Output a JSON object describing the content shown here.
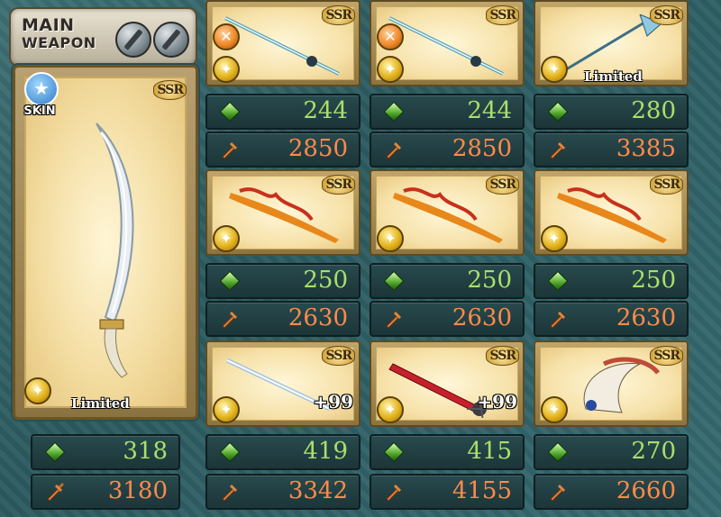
{
  "header": {
    "line1": "MAIN",
    "line2": "WEAPON"
  },
  "main": {
    "skin_label": "SKIN",
    "rarity": "SSR",
    "tag": "Limited",
    "hp": "318",
    "atk": "3180"
  },
  "grid": [
    {
      "rarity": "SSR",
      "element": "fire",
      "tag": "",
      "plus": "",
      "hp": "244",
      "atk": "2850"
    },
    {
      "rarity": "SSR",
      "element": "fire",
      "tag": "",
      "plus": "",
      "hp": "244",
      "atk": "2850"
    },
    {
      "rarity": "SSR",
      "element": "light",
      "tag": "Limited",
      "plus": "",
      "hp": "280",
      "atk": "3385"
    },
    {
      "rarity": "SSR",
      "element": "light",
      "tag": "",
      "plus": "",
      "hp": "250",
      "atk": "2630"
    },
    {
      "rarity": "SSR",
      "element": "light",
      "tag": "",
      "plus": "",
      "hp": "250",
      "atk": "2630"
    },
    {
      "rarity": "SSR",
      "element": "light",
      "tag": "",
      "plus": "",
      "hp": "250",
      "atk": "2630"
    },
    {
      "rarity": "SSR",
      "element": "light",
      "tag": "",
      "plus": "+99",
      "hp": "419",
      "atk": "3342"
    },
    {
      "rarity": "SSR",
      "element": "light",
      "tag": "",
      "plus": "+99",
      "hp": "415",
      "atk": "4155"
    },
    {
      "rarity": "SSR",
      "element": "light",
      "tag": "",
      "plus": "",
      "hp": "270",
      "atk": "2660"
    }
  ],
  "icons": {
    "hp": "hp-gem-icon",
    "atk": "atk-sword-icon",
    "element": "element-icon"
  },
  "colors": {
    "hp_text": "#a8e06a",
    "atk_text": "#ff8a4a",
    "panel": "#1c3538",
    "card_frame": "#8c7440"
  }
}
